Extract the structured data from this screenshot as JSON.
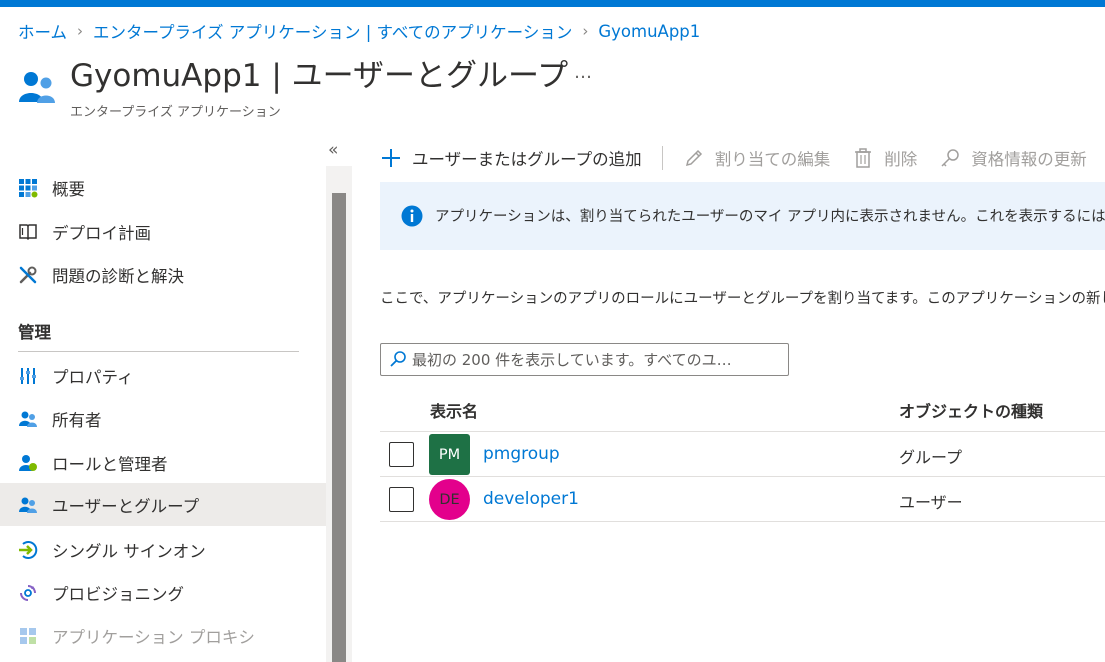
{
  "colors": {
    "accent": "#0078d4",
    "selected_bg": "#edebe9",
    "info_bg": "#ebf3fc",
    "avatar_pm": "#1e7145",
    "avatar_de": "#e3008c"
  },
  "breadcrumb": {
    "items": [
      "ホーム",
      "エンタープライズ アプリケーション | すべてのアプリケーション",
      "GyomuApp1"
    ]
  },
  "header": {
    "title": "GyomuApp1 | ユーザーとグループ",
    "more": "…",
    "subtitle": "エンタープライズ アプリケーション",
    "icon": "users-icon"
  },
  "sidebar": {
    "collapse_glyph": "«",
    "items": [
      {
        "label": "概要",
        "icon": "grid-icon"
      },
      {
        "label": "デプロイ計画",
        "icon": "book-icon"
      },
      {
        "label": "問題の診断と解決",
        "icon": "wrench-icon"
      }
    ],
    "section": "管理",
    "manage_items": [
      {
        "label": "プロパティ",
        "icon": "properties-icon"
      },
      {
        "label": "所有者",
        "icon": "owners-icon"
      },
      {
        "label": "ロールと管理者",
        "icon": "roles-icon"
      },
      {
        "label": "ユーザーとグループ",
        "icon": "users-groups-icon",
        "selected": true
      },
      {
        "label": "シングル サインオン",
        "icon": "sso-icon"
      },
      {
        "label": "プロビジョニング",
        "icon": "provisioning-icon"
      },
      {
        "label": "アプリケーション プロキシ",
        "icon": "app-proxy-icon",
        "disabled": true
      }
    ]
  },
  "toolbar": {
    "add": "ユーザーまたはグループの追加",
    "edit": "割り当ての編集",
    "delete": "削除",
    "update_credentials": "資格情報の更新"
  },
  "info": {
    "text": "アプリケーションは、割り当てられたユーザーのマイ アプリ内に表示されません。これを表示するには、プロパティ"
  },
  "description": "ここで、アプリケーションのアプリのロールにユーザーとグループを割り当てます。このアプリケーションの新しいアプリ",
  "search": {
    "placeholder": "最初の 200 件を表示しています。すべてのユ…"
  },
  "table": {
    "columns": [
      "表示名",
      "オブジェクトの種類"
    ],
    "rows": [
      {
        "initials": "PM",
        "name": "pmgroup",
        "type": "グループ"
      },
      {
        "initials": "DE",
        "name": "developer1",
        "type": "ユーザー"
      }
    ]
  }
}
